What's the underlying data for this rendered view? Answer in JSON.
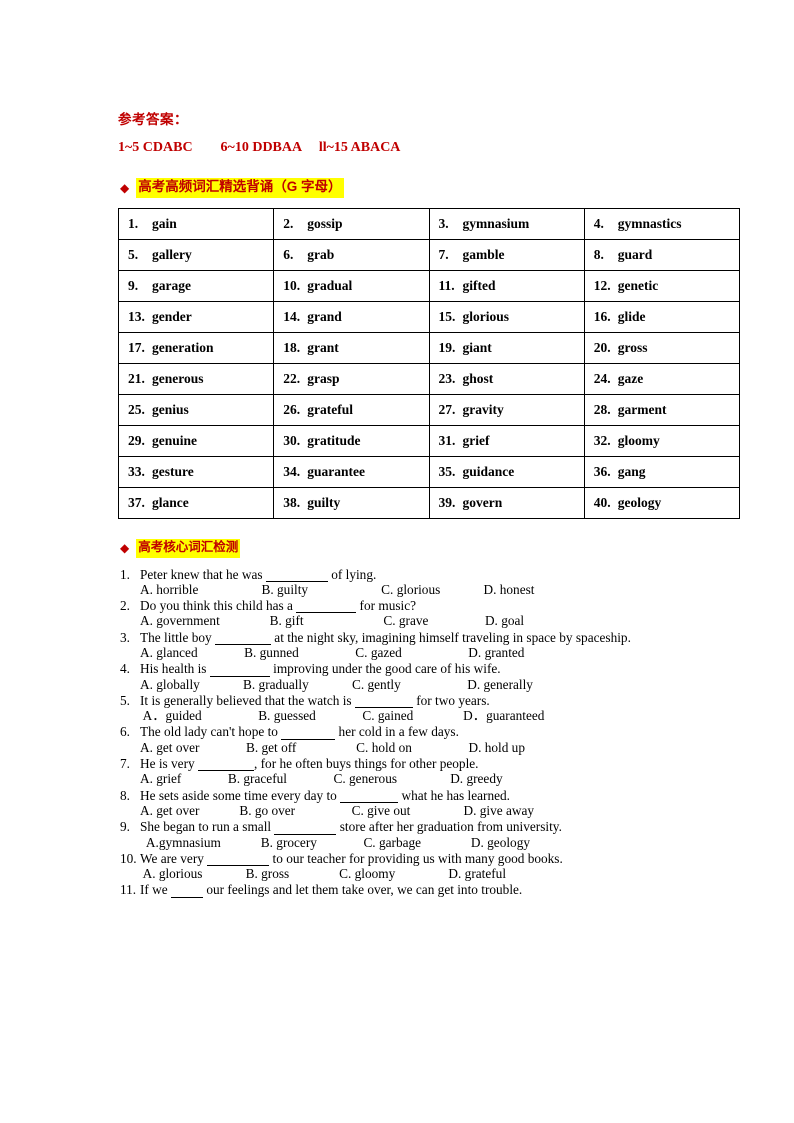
{
  "answers": {
    "title": "参考答案：",
    "line": "1~5 CDABC        6~10 DDBAA     ll~15 ABACA"
  },
  "sections": [
    {
      "diamond": "◆",
      "title": "高考高频词汇精选背诵（G 字母）"
    },
    {
      "diamond": "◆",
      "title": "高考核心词汇检测"
    }
  ],
  "vocab_rows": [
    [
      {
        "n": "1.",
        "w": "gain"
      },
      {
        "n": "2.",
        "w": "gossip"
      },
      {
        "n": "3.",
        "w": "gymnasium"
      },
      {
        "n": "4.",
        "w": "gymnastics"
      }
    ],
    [
      {
        "n": "5.",
        "w": "gallery"
      },
      {
        "n": "6.",
        "w": "grab"
      },
      {
        "n": "7.",
        "w": "gamble"
      },
      {
        "n": "8.",
        "w": "guard"
      }
    ],
    [
      {
        "n": "9.",
        "w": "garage"
      },
      {
        "n": "10.",
        "w": "gradual"
      },
      {
        "n": "11.",
        "w": "gifted"
      },
      {
        "n": "12.",
        "w": "genetic"
      }
    ],
    [
      {
        "n": "13.",
        "w": "gender"
      },
      {
        "n": "14.",
        "w": "grand"
      },
      {
        "n": "15.",
        "w": "glorious"
      },
      {
        "n": "16.",
        "w": "glide"
      }
    ],
    [
      {
        "n": "17.",
        "w": "generation"
      },
      {
        "n": "18.",
        "w": "grant"
      },
      {
        "n": "19.",
        "w": "giant"
      },
      {
        "n": "20.",
        "w": "gross"
      }
    ],
    [
      {
        "n": "21.",
        "w": "generous"
      },
      {
        "n": "22.",
        "w": "grasp"
      },
      {
        "n": "23.",
        "w": "ghost"
      },
      {
        "n": "24.",
        "w": "gaze"
      }
    ],
    [
      {
        "n": "25.",
        "w": "genius"
      },
      {
        "n": "26.",
        "w": "grateful"
      },
      {
        "n": "27.",
        "w": "gravity"
      },
      {
        "n": "28.",
        "w": "garment"
      }
    ],
    [
      {
        "n": "29.",
        "w": "genuine"
      },
      {
        "n": "30.",
        "w": "gratitude"
      },
      {
        "n": "31.",
        "w": "grief"
      },
      {
        "n": "32.",
        "w": "gloomy"
      }
    ],
    [
      {
        "n": "33.",
        "w": "gesture"
      },
      {
        "n": "34.",
        "w": "guarantee"
      },
      {
        "n": "35.",
        "w": "guidance"
      },
      {
        "n": "36.",
        "w": "gang"
      }
    ],
    [
      {
        "n": "37.",
        "w": "glance"
      },
      {
        "n": "38.",
        "w": "guilty"
      },
      {
        "n": "39.",
        "w": "govern"
      },
      {
        "n": "40.",
        "w": "geology"
      }
    ]
  ],
  "questions": [
    {
      "num": "1.",
      "stem_pre": "Peter knew that he was ",
      "blank_w": 62,
      "stem_post": " of lying.",
      "options": "A. horrible                   B. guilty                      C. glorious             D. honest"
    },
    {
      "num": "2.",
      "stem_pre": "Do you think this child has a ",
      "blank_w": 60,
      "stem_post": " for music?",
      "options": "A. government               B. gift                        C. grave                 D. goal"
    },
    {
      "num": "3.",
      "stem_pre": "The little boy ",
      "blank_w": 56,
      "stem_post": " at the night sky, imagining himself traveling in space by spaceship.",
      "options": "A. glanced              B. gunned                 C. gazed                    D. granted"
    },
    {
      "num": "4.",
      "stem_pre": "His health is ",
      "blank_w": 60,
      "stem_post": " improving under the good care of his wife.",
      "options": "A. globally             B. gradually             C. gently                    D. generally"
    },
    {
      "num": "5.",
      "stem_pre": "It is generally believed that the watch is ",
      "blank_w": 58,
      "stem_post": " for two years.",
      "options": " A．guided                 B. guessed              C. gained               D．guaranteed"
    },
    {
      "num": "6.",
      "stem_pre": "The old lady can't hope to ",
      "blank_w": 54,
      "stem_post": " her cold in a few days.",
      "options": "A. get over              B. get off                  C. hold on                 D. hold up"
    },
    {
      "num": "7.",
      "stem_pre": "He is very ",
      "blank_w": 56,
      "stem_post": ", for he often buys things for other people.",
      "options": "A. grief              B. graceful              C. generous                D. greedy"
    },
    {
      "num": "8.",
      "stem_pre": "He sets aside some time every day to ",
      "blank_w": 58,
      "stem_post": " what he has learned.",
      "options": "A. get over            B. go over                 C. give out                D. give away"
    },
    {
      "num": "9.",
      "stem_pre": "She began to run a small ",
      "blank_w": 62,
      "stem_post": " store after her graduation from university.",
      "options": "  A.gymnasium            B. grocery              C. garbage               D. geology"
    },
    {
      "num": "10.",
      "stem_pre": "We are very ",
      "blank_w": 62,
      "stem_post": " to our teacher for providing us with many good books.",
      "options": " A. glorious             B. gross               C. gloomy                D. grateful"
    },
    {
      "num": "11.",
      "stem_pre": "If we ",
      "blank_w": 32,
      "stem_post": " our feelings and let them take over, we can get into trouble.",
      "options": ""
    }
  ]
}
